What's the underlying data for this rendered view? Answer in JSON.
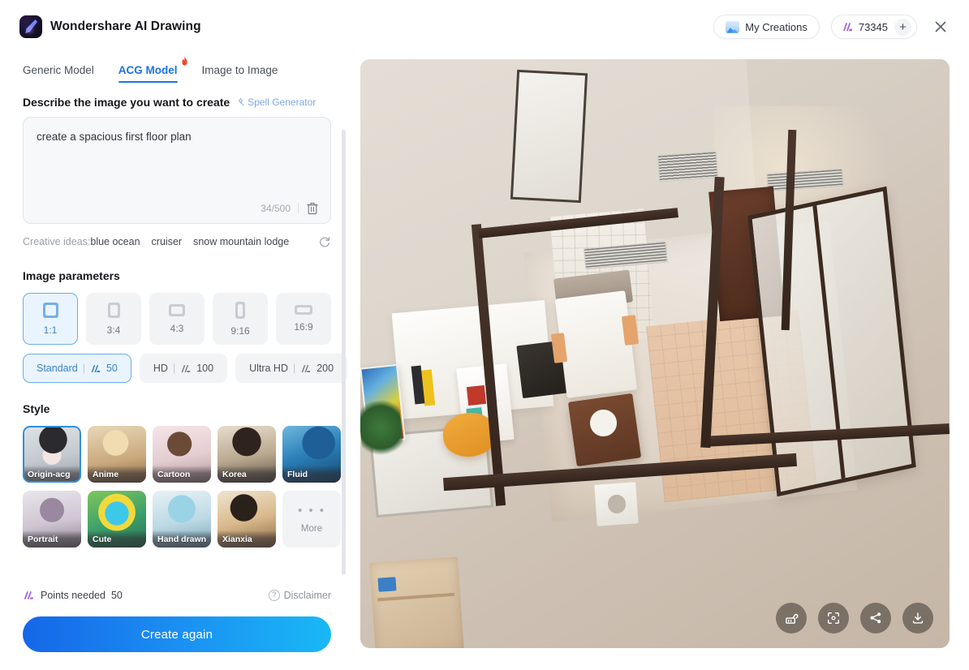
{
  "header": {
    "app_title": "Wondershare AI Drawing",
    "logo_icon": "wondershare-logo-icon",
    "my_creations_label": "My Creations",
    "my_creations_icon": "image-gallery-icon",
    "points_value": "73345",
    "points_icon": "points-coin-icon",
    "add_points_label": "+",
    "close_label": "✕"
  },
  "tabs": [
    {
      "label": "Generic Model",
      "active": false,
      "badge": null
    },
    {
      "label": "ACG Model",
      "active": true,
      "badge": "fire-icon"
    },
    {
      "label": "Image to Image",
      "active": false,
      "badge": null
    }
  ],
  "prompt": {
    "heading": "Describe the image you want to create",
    "spell_generator_label": "Spell Generator",
    "spell_icon": "sparkle-diamond-icon",
    "value": "create a spacious first floor plan",
    "placeholder": "Describe the image you want to create",
    "counter": "34/500",
    "clear_icon": "trash-icon"
  },
  "ideas": {
    "label": "Creative ideas:",
    "items": [
      "blue ocean",
      "cruiser",
      "snow mountain lodge"
    ],
    "refresh_icon": "refresh-icon"
  },
  "image_parameters": {
    "title": "Image parameters",
    "ratios": [
      {
        "label": "1:1",
        "active": true
      },
      {
        "label": "3:4",
        "active": false
      },
      {
        "label": "4:3",
        "active": false
      },
      {
        "label": "9:16",
        "active": false
      },
      {
        "label": "16:9",
        "active": false
      }
    ],
    "qualities": [
      {
        "label": "Standard",
        "separator": "|",
        "cost": "50",
        "active": true
      },
      {
        "label": "HD",
        "separator": "|",
        "cost": "100",
        "active": false
      },
      {
        "label": "Ultra HD",
        "separator": "|",
        "cost": "200",
        "active": false
      }
    ]
  },
  "style": {
    "title": "Style",
    "items": [
      {
        "label": "Origin-acg",
        "active": true
      },
      {
        "label": "Anime",
        "active": false
      },
      {
        "label": "Cartoon",
        "active": false
      },
      {
        "label": "Korea",
        "active": false
      },
      {
        "label": "Fluid",
        "active": false
      },
      {
        "label": "Portrait",
        "active": false
      },
      {
        "label": "Cute",
        "active": false
      },
      {
        "label": "Hand drawn",
        "active": false
      },
      {
        "label": "Xianxia",
        "active": false
      }
    ],
    "more_label": "More",
    "more_dots": "• • •"
  },
  "footer": {
    "points_needed_label": "Points needed",
    "points_needed_value": "50",
    "points_icon": "points-coin-icon",
    "disclaimer_label": "Disclaimer",
    "help_icon": "question-mark-icon",
    "create_button_label": "Create again"
  },
  "preview": {
    "alt": "AI generated spacious first floor plan interior render",
    "tools": [
      {
        "name": "retouch-icon",
        "label": "Retouch"
      },
      {
        "name": "fullscreen-icon",
        "label": "Fullscreen"
      },
      {
        "name": "share-icon",
        "label": "Share"
      },
      {
        "name": "download-icon",
        "label": "Download"
      }
    ]
  },
  "colors": {
    "accent": "#1b74e4",
    "accent_light": "#eaf4fe",
    "accent_border": "#6aaee8",
    "text_primary": "#16181c",
    "text_muted": "#9aa0a8",
    "panel_bg": "#f2f3f5",
    "button_gradient_from": "#1567e8",
    "button_gradient_to": "#19b8f5"
  }
}
